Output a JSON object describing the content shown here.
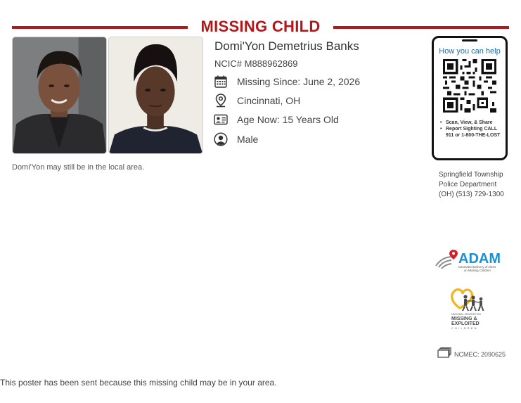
{
  "poster": {
    "title": "MISSING CHILD",
    "name": "Domi'Yon Demetrius Banks",
    "ncic": "NCIC# M888962869",
    "details": {
      "missing_since": "Missing Since: June 2, 2026",
      "location": "Cincinnati, OH",
      "age": "Age Now: 15 Years Old",
      "sex": "Male"
    },
    "caption": "Domi'Yon may still be in the local area."
  },
  "phone_card": {
    "heading": "How you can help",
    "bullets": [
      "Scan, View, & Share",
      "Report Sighting CALL 911 or 1-800-THE-LOST"
    ]
  },
  "agency": {
    "line1": "Springfield Township",
    "line2": "Police Department",
    "phone": "(OH) (513) 729-1300"
  },
  "logos": {
    "adam": "ADAM",
    "adam_sub1": "Automated Delivery of Alerts",
    "adam_sub2": "on Missing Children",
    "ncmec_line1": "NATIONAL CENTER FOR",
    "ncmec_line2": "MISSING &",
    "ncmec_line3": "EXPLOITED",
    "ncmec_line4": "CHILDREN"
  },
  "case_number": "NCMEC: 2090625",
  "footer": "This poster has been sent because this missing child may be in your area.",
  "colors": {
    "accent": "#b0191c",
    "link": "#1d6fa8",
    "adam_blue": "#1c8fd0"
  }
}
